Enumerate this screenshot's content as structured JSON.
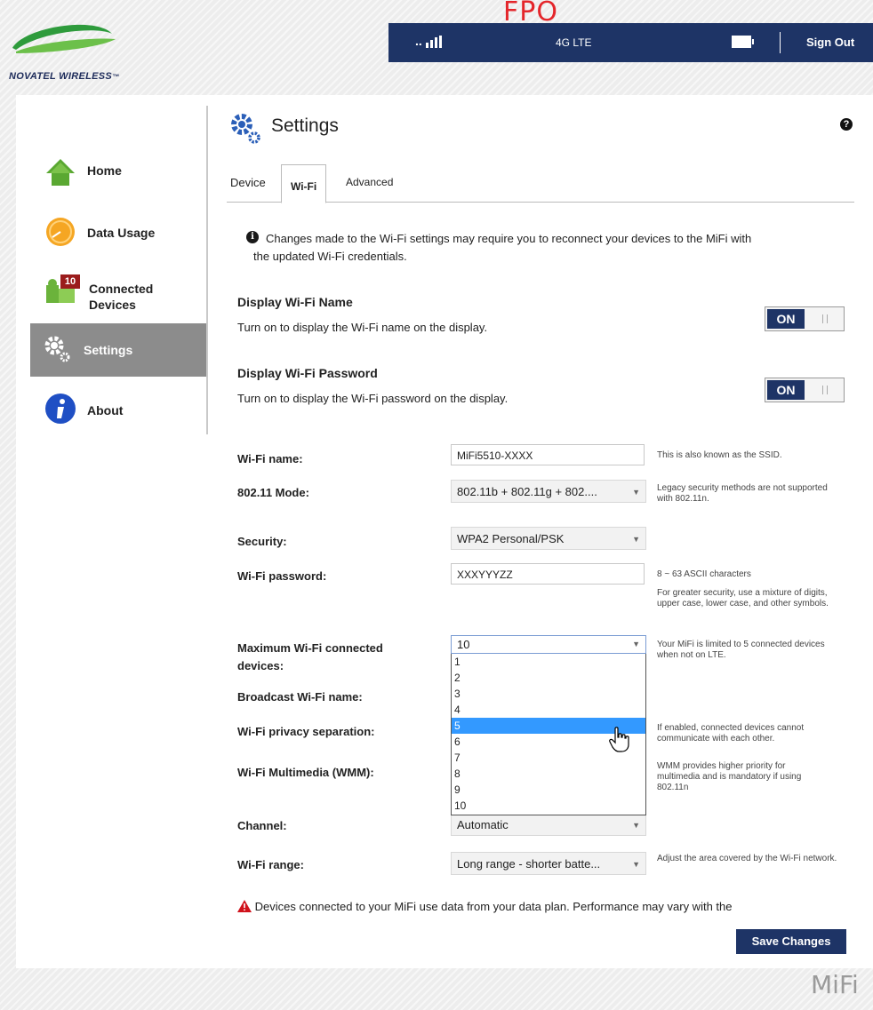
{
  "header": {
    "logo_text": "NOVATEL WIRELESS",
    "logo_suffix": "",
    "fpo": "FPO",
    "signal_dots": "..",
    "network": "4G LTE",
    "sign_out": "Sign Out"
  },
  "sidebar": {
    "items": [
      {
        "label": "Home"
      },
      {
        "label": "Data Usage"
      },
      {
        "label": "Connected",
        "label2": "Devices",
        "badge": "10"
      },
      {
        "label": "Settings"
      },
      {
        "label": "About"
      }
    ]
  },
  "page": {
    "title": "Settings",
    "help": "?",
    "tabs": [
      "Device",
      "Wi-Fi",
      "Advanced"
    ],
    "notice_line1": "Changes made to the Wi-Fi settings may require you to reconnect your devices to the MiFi with",
    "notice_line2": "the updated Wi-Fi credentials."
  },
  "display_name": {
    "title": "Display Wi-Fi Name",
    "desc": "Turn on to display the Wi-Fi name on the display.",
    "toggle": "ON"
  },
  "display_password": {
    "title": "Display Wi-Fi Password",
    "desc": "Turn on to display the Wi-Fi password on the display.",
    "toggle": "ON"
  },
  "form": {
    "wifi_name_label": "Wi-Fi name:",
    "wifi_name_value": "MiFi5510-XXXX",
    "wifi_name_help": "This is also known as the SSID.",
    "mode_label": "802.11 Mode:",
    "mode_value": "802.11b + 802.11g + 802....",
    "mode_help": "Legacy security methods are not supported with 802.11n.",
    "security_label": "Security:",
    "security_value": "WPA2 Personal/PSK",
    "password_label": "Wi-Fi password:",
    "password_value": "XXXYYYZZ",
    "password_help1": "8 ~ 63 ASCII characters",
    "password_help2": "For greater security, use a mixture of digits, upper case, lower case, and other symbols.",
    "maxdev_label1": "Maximum Wi-Fi connected",
    "maxdev_label2": "devices:",
    "maxdev_value": "10",
    "maxdev_help": "Your MiFi is limited to 5 connected devices when not on LTE.",
    "maxdev_options": [
      "1",
      "2",
      "3",
      "4",
      "5",
      "6",
      "7",
      "8",
      "9",
      "10"
    ],
    "maxdev_highlighted": "5",
    "broadcast_label": "Broadcast Wi-Fi name:",
    "privacy_label": "Wi-Fi privacy separation:",
    "privacy_help": "If enabled, connected devices cannot communicate with each other.",
    "wmm_label": "Wi-Fi Multimedia (WMM):",
    "wmm_help": "WMM provides higher priority for multimedia and is mandatory if using 802.11n",
    "channel_label": "Channel:",
    "channel_value": "Automatic",
    "range_label": "Wi-Fi range:",
    "range_value": "Long range - shorter batte...",
    "range_help": "Adjust the area covered by the Wi-Fi network."
  },
  "warning": "Devices connected to your MiFi use data from your data plan. Performance may vary with the",
  "save_label": "Save Changes",
  "footer_logo": "MiFi",
  "colors": {
    "brand_navy": "#1e3466",
    "highlight": "#3399ff",
    "badge": "#9b1c1c",
    "active_nav": "#8c8c8c"
  }
}
